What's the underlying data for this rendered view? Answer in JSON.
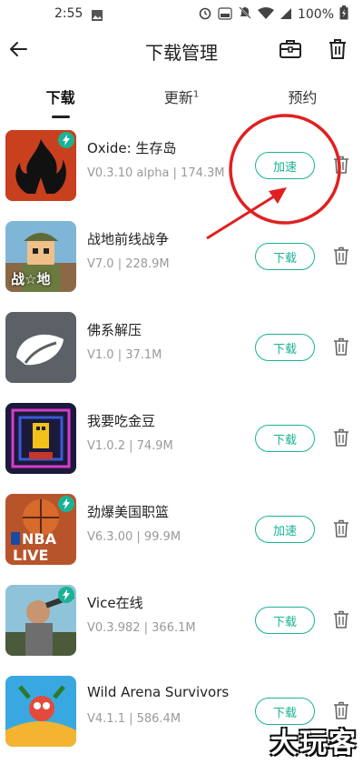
{
  "status_bar": {
    "time": "2:55",
    "battery": "100%"
  },
  "header": {
    "title": "下载管理",
    "back_icon": "back-arrow-icon",
    "toolbox_icon": "toolbox-icon",
    "delete_icon": "trash-icon"
  },
  "tabs": [
    {
      "label": "下载",
      "sup": "",
      "active": true
    },
    {
      "label": "更新",
      "sup": "1",
      "active": false
    },
    {
      "label": "预约",
      "sup": "",
      "active": false
    }
  ],
  "downloads": [
    {
      "name": "Oxide: 生存岛",
      "meta": "V0.3.10 alpha | 174.3M",
      "action": "加速",
      "boost_badge": true
    },
    {
      "name": "战地前线战争",
      "meta": "V7.0 | 228.9M",
      "action": "下载",
      "boost_badge": false
    },
    {
      "name": "佛系解压",
      "meta": "V1.0 | 37.1M",
      "action": "下载",
      "boost_badge": false
    },
    {
      "name": "我要吃金豆",
      "meta": "V1.0.2 | 74.9M",
      "action": "下载",
      "boost_badge": false
    },
    {
      "name": "劲爆美国职篮",
      "meta": "V6.3.00 | 99.9M",
      "action": "加速",
      "boost_badge": true
    },
    {
      "name": "Vice在线",
      "meta": "V0.3.982 | 366.1M",
      "action": "下载",
      "boost_badge": true
    },
    {
      "name": "Wild Arena Survivors",
      "meta": "V4.1.1 | 586.4M",
      "action": "下载",
      "boost_badge": false
    }
  ],
  "icon_labels": {
    "war": "战☆地",
    "nba": "NBA",
    "live": "LIVE"
  },
  "watermark": "大玩客",
  "colors": {
    "accent": "#19b394",
    "annotation": "#e02020"
  }
}
